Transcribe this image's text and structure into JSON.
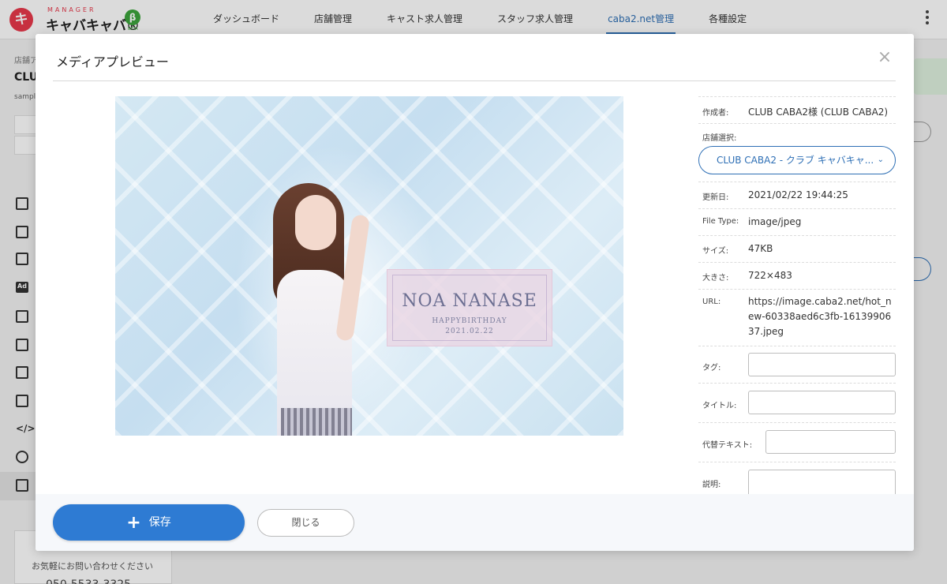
{
  "app": {
    "logo_badge": "キ",
    "logo_subtitle": "MANAGER",
    "logo_title": "キャバキャバ®",
    "logo_beta_icon": "β",
    "logo_beta_label": "BETA"
  },
  "nav": {
    "items": [
      {
        "label": "ダッシュボード"
      },
      {
        "label": "店舗管理"
      },
      {
        "label": "キャスト求人管理"
      },
      {
        "label": "スタッフ求人管理"
      },
      {
        "label": "caba2.net管理"
      },
      {
        "label": "各種設定"
      }
    ],
    "active_index": 4
  },
  "background": {
    "sidebar_label": "店舗ア",
    "sidebar_title": "CLUB",
    "sidebar_sub": "sampl",
    "contact_text": "お気軽にお問い合わせください",
    "contact_number": "050-5533-3325",
    "ad_icon_text": "Ad",
    "code_icon_text": "</>"
  },
  "modal": {
    "title": "メディアプレビュー",
    "close_icon": "×",
    "image": {
      "name": "NOA NANASE",
      "caption": "HAPPYBIRTHDAY",
      "date": "2021.02.22"
    },
    "details": {
      "creator_label": "作成者:",
      "creator_value": "CLUB CABA2様 (CLUB CABA2)",
      "store_label": "店舗選択:",
      "store_value": "CLUB CABA2 - クラブ キャバキャ...",
      "updated_label": "更新日:",
      "updated_value": "2021/02/22 19:44:25",
      "filetype_label": "File Type:",
      "filetype_value": "image/jpeg",
      "size_label": "サイズ:",
      "size_value": "47KB",
      "dimensions_label": "大きさ:",
      "dimensions_value": "722×483",
      "url_label": "URL:",
      "url_value": "https://image.caba2.net/hot_new-60338aed6c3fb-1613990637.jpeg",
      "tag_label": "タグ:",
      "tag_value": "",
      "title_label": "タイトル:",
      "title_value": "",
      "alt_label": "代替テキスト:",
      "alt_value": "",
      "description_label": "説明:",
      "description_value": ""
    },
    "footer": {
      "save_label": "保存",
      "save_icon": "+",
      "close_label": "閉じる"
    }
  },
  "colors": {
    "accent": "#2e6fb5",
    "primary_button": "#2e7bd3",
    "brand_red": "#e8394b",
    "beta_green": "#3ca53c"
  }
}
